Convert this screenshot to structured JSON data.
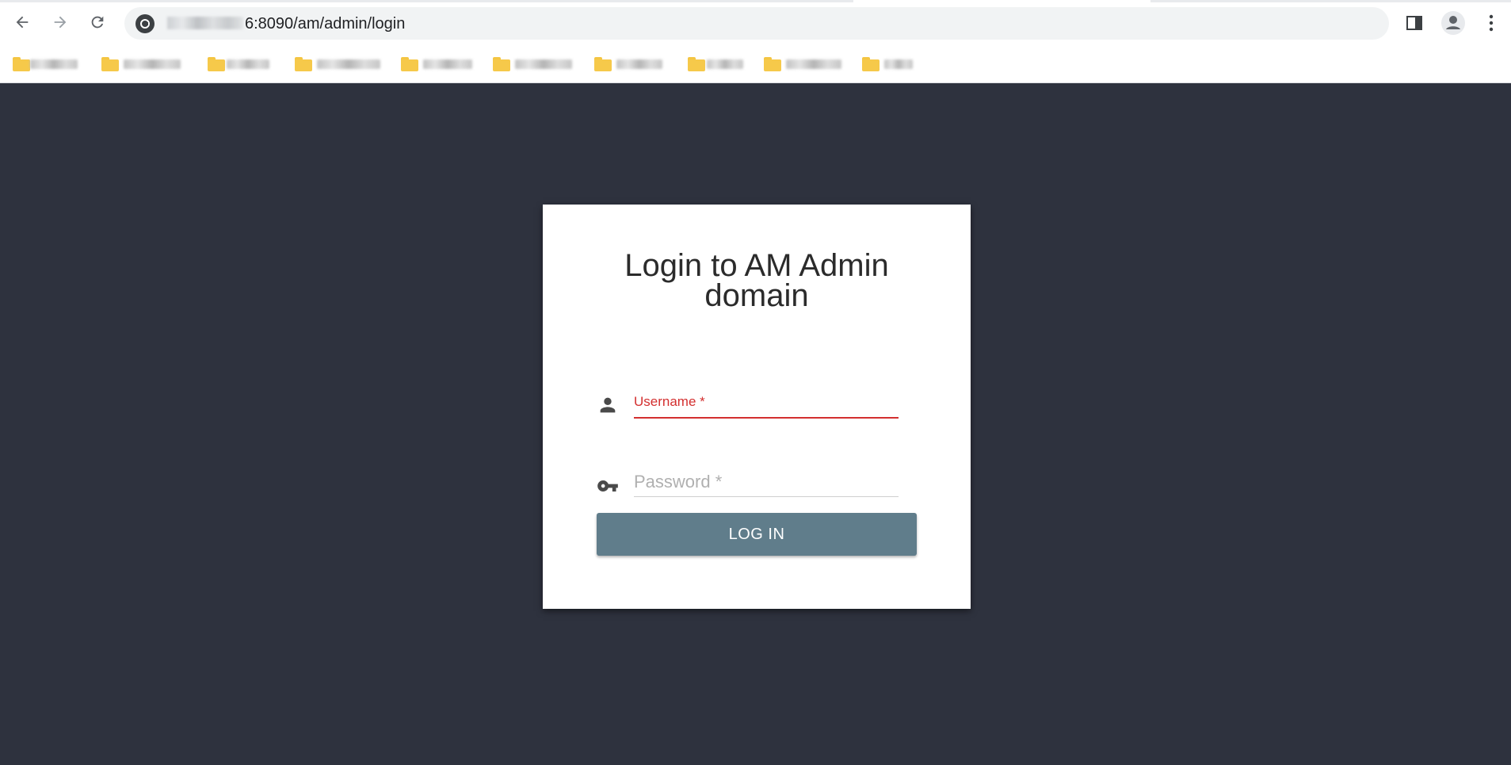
{
  "browser": {
    "url_visible": "6:8090/am/admin/login",
    "bookmarks_count_label": "",
    "icons": {
      "back": "arrow-left-icon",
      "forward": "arrow-right-icon",
      "reload": "reload-icon",
      "site_info": "site-info-icon",
      "side_panel": "side-panel-icon",
      "profile": "profile-avatar-icon",
      "menu": "more-vert-icon",
      "bookmark": "folder-icon"
    }
  },
  "login": {
    "title_line1": "Login to AM Admin",
    "title_line2": "domain",
    "username_label": "Username *",
    "password_placeholder": "Password *",
    "login_button": "LOG IN",
    "icons": {
      "user": "person-icon",
      "password": "key-icon"
    }
  },
  "colors": {
    "background": "#2e323e",
    "button": "#607d8b",
    "error_red": "#d32f2f"
  }
}
